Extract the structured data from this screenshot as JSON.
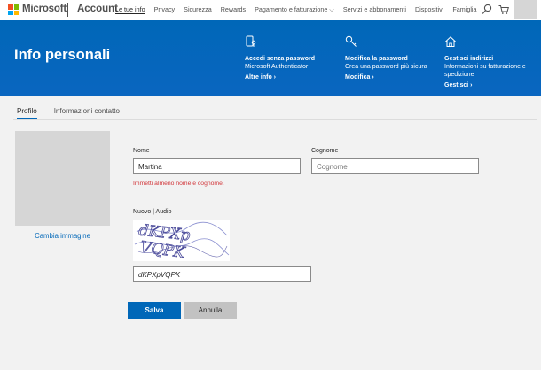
{
  "topnav": {
    "brand": "Microsoft",
    "section": "Account",
    "links": [
      "Le tue info",
      "Privacy",
      "Sicurezza",
      "Rewards",
      "Pagamento e fatturazione ⌵",
      "Servizi e abbonamenti",
      "Dispositivi",
      "Famiglia"
    ],
    "active_link": "Le tue info",
    "logo_colors": [
      "#f25022",
      "#7fba00",
      "#00a4ef",
      "#ffb900"
    ]
  },
  "hero": {
    "title": "Info personali",
    "bg_color": "#0067b8",
    "columns": [
      {
        "icon": "phone-key-icon",
        "title": "Accedi senza password",
        "text": "Microsoft Authenticator",
        "link": "Altre info ›"
      },
      {
        "icon": "key-icon",
        "title": "Modifica la password",
        "text": "Crea una password più sicura",
        "link": "Modifica ›"
      },
      {
        "icon": "home-icon",
        "title": "Gestisci indirizzi",
        "text": "Informazioni su fatturazione e spedizione",
        "link": "Gestisci ›"
      }
    ]
  },
  "tabs": {
    "profile": "Profilo",
    "contact": "Informazioni contatto"
  },
  "profile": {
    "change_image": "Cambia immagine"
  },
  "form": {
    "first_name_label": "Nome",
    "first_name_value": "Martina",
    "last_name_label": "Cognome",
    "last_name_placeholder": "Cognome",
    "error": "Immetti almeno nome e cognome.",
    "captcha_label": "Nuovo | Audio",
    "captcha_text": "dKPXpVQPK",
    "captcha_value": "dKPXpVQPK",
    "save": "Salva",
    "cancel": "Annulla"
  }
}
